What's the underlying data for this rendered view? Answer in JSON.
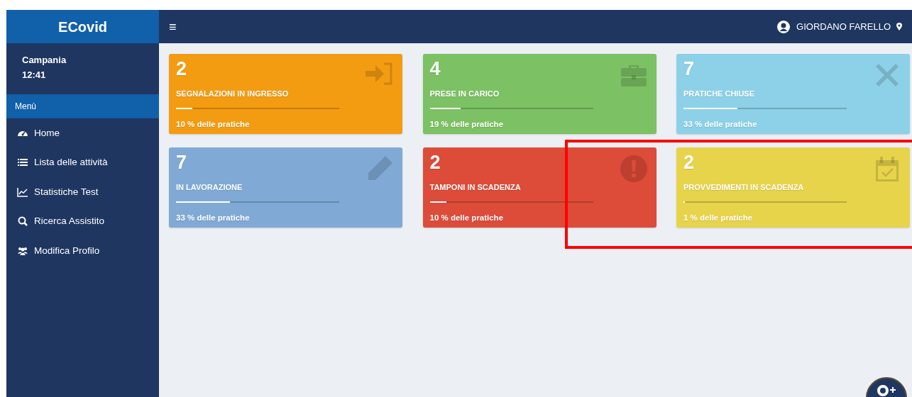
{
  "brand": "ECovid",
  "user_panel": {
    "region": "Campania",
    "time": "12:41"
  },
  "menu_header": "Menù",
  "menu": [
    {
      "label": "Home",
      "kind": "dashboard"
    },
    {
      "label": "Lista delle attività",
      "kind": "list"
    },
    {
      "label": "Statistiche Test",
      "kind": "chart"
    },
    {
      "label": "Ricerca Assistito",
      "kind": "search"
    },
    {
      "label": "Modifica Profilo",
      "kind": "users"
    }
  ],
  "toggle": "≡",
  "user_name": "GIORDANO FARELLO",
  "cards": [
    {
      "value": "2",
      "title": "SEGNALAZIONI IN INGRESSO",
      "level": 0.1,
      "footer": "10 % delle pratiche",
      "color": "#f39c12",
      "kind": "sign-in"
    },
    {
      "value": "4",
      "title": "PRESE IN CARICO",
      "level": 0.19,
      "footer": "19 % delle pratiche",
      "color": "#7cc163",
      "kind": "briefcase"
    },
    {
      "value": "7",
      "title": "PRATICHE CHIUSE",
      "level": 0.33,
      "footer": "33 % delle pratiche",
      "color": "#8dd1e8",
      "kind": "close"
    },
    {
      "value": "7",
      "title": "IN LAVORAZIONE",
      "level": 0.33,
      "footer": "33 % delle pratiche",
      "color": "#80aad5",
      "kind": "pencil"
    },
    {
      "value": "2",
      "title": "TAMPONI IN SCADENZA",
      "level": 0.1,
      "footer": "10 % delle pratiche",
      "color": "#dd4b39",
      "kind": "alert"
    },
    {
      "value": "2",
      "title": "PROVVEDIMENTI IN SCADENZA",
      "level": 0.01,
      "footer": "1 % delle pratiche",
      "color": "#e7d44a",
      "kind": "calendar"
    }
  ]
}
